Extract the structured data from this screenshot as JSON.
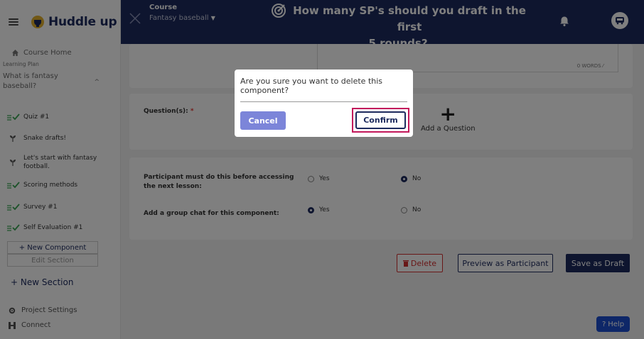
{
  "app": {
    "logo_text": "Huddle up"
  },
  "header": {
    "crumb_label": "Course",
    "crumb_value": "Fantasy baseball",
    "title_line1": "How many SP's should you draft in the first",
    "title_line2": "5 rounds?"
  },
  "sidebar": {
    "course_home": "Course Home",
    "learning_plan": "Learning Plan",
    "section_title": "What is fantasy baseball?",
    "items": [
      {
        "label": "Quiz #1",
        "icon": "checklist-icon"
      },
      {
        "label": "Snake drafts!",
        "icon": "plant-icon"
      },
      {
        "label": "Let's start with fantasy football.",
        "icon": "plant-icon"
      },
      {
        "label": "Scoring methods",
        "icon": "checklist-icon"
      },
      {
        "label": "Survey #1",
        "icon": "checklist-icon"
      },
      {
        "label": "Self Evaluation #1",
        "icon": "checklist-icon"
      }
    ],
    "new_component": "+ New Component",
    "edit_section": "Edit Section",
    "new_section": "+ New Section",
    "project_settings": "Project Settings",
    "connect": "Connect"
  },
  "editor": {
    "word_count": "0 WORDS",
    "questions_label": "Question(s):",
    "required_mark": "*",
    "add_question": "Add a Question",
    "prereq_label": "Participant must do this before accessing the next lesson:",
    "group_chat_label": "Add a group chat for this component:",
    "yes": "Yes",
    "no": "No",
    "prereq_value": "No",
    "group_chat_value": "Yes"
  },
  "actions": {
    "delete": "Delete",
    "preview": "Preview as Participant",
    "save_draft": "Save as Draft",
    "help": "Help"
  },
  "modal": {
    "message": "Are you sure you want to delete this component?",
    "cancel": "Cancel",
    "confirm": "Confirm"
  },
  "colors": {
    "brand_navy": "#1d2b5e",
    "cancel_bg": "#7c85d9",
    "delete_red": "#d32f2f",
    "highlight_ring": "#c2185b",
    "help_blue": "#1d4fd1"
  }
}
